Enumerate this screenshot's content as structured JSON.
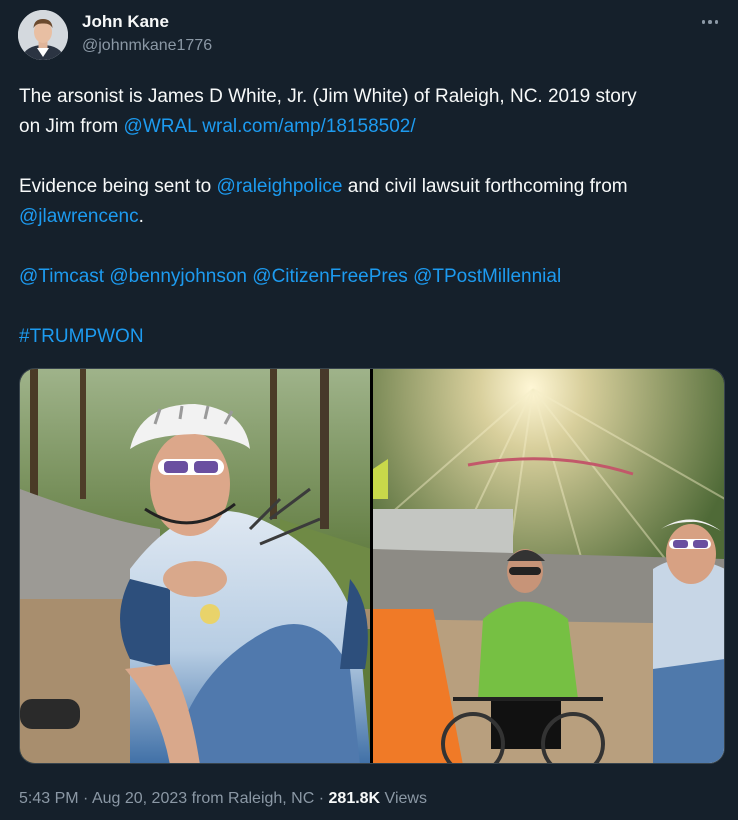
{
  "author": {
    "display_name": "John Kane",
    "handle": "@johnmkane1776",
    "avatar": "avatar-icon"
  },
  "more_icon": "more-horizontal-icon",
  "tweet": {
    "line1": "The arsonist is James D White, Jr. (Jim White) of Raleigh, NC.  2019 story",
    "line2_prefix": "on Jim from ",
    "mention_wral": "@WRAL",
    "link_wral": "wral.com/amp/18158502/",
    "line3_prefix": "Evidence being sent to ",
    "mention_raleighpolice": "@raleighpolice",
    "line3_suffix": " and civil lawsuit forthcoming from",
    "mention_jlawrencenc": "@jlawrencenc",
    "line4_suffix": ".",
    "mentions": [
      "@Timcast",
      "@bennyjohnson",
      "@CitizenFreePres",
      "@TPostMillennial"
    ],
    "hashtag": "#TRUMPWON"
  },
  "media": {
    "images": [
      {
        "name": "cyclist-closeup-photo"
      },
      {
        "name": "cyclists-group-photo"
      }
    ]
  },
  "footer": {
    "time": "5:43 PM",
    "sep1": " · ",
    "date": "Aug 20, 2023",
    "location": " from Raleigh, NC",
    "sep2": " · ",
    "views_count": "281.8K",
    "views_label": " Views"
  },
  "colors": {
    "background": "#15202b",
    "link": "#1d9bf0",
    "secondary_text": "#8b98a5",
    "primary_text": "#f7f9f9"
  }
}
